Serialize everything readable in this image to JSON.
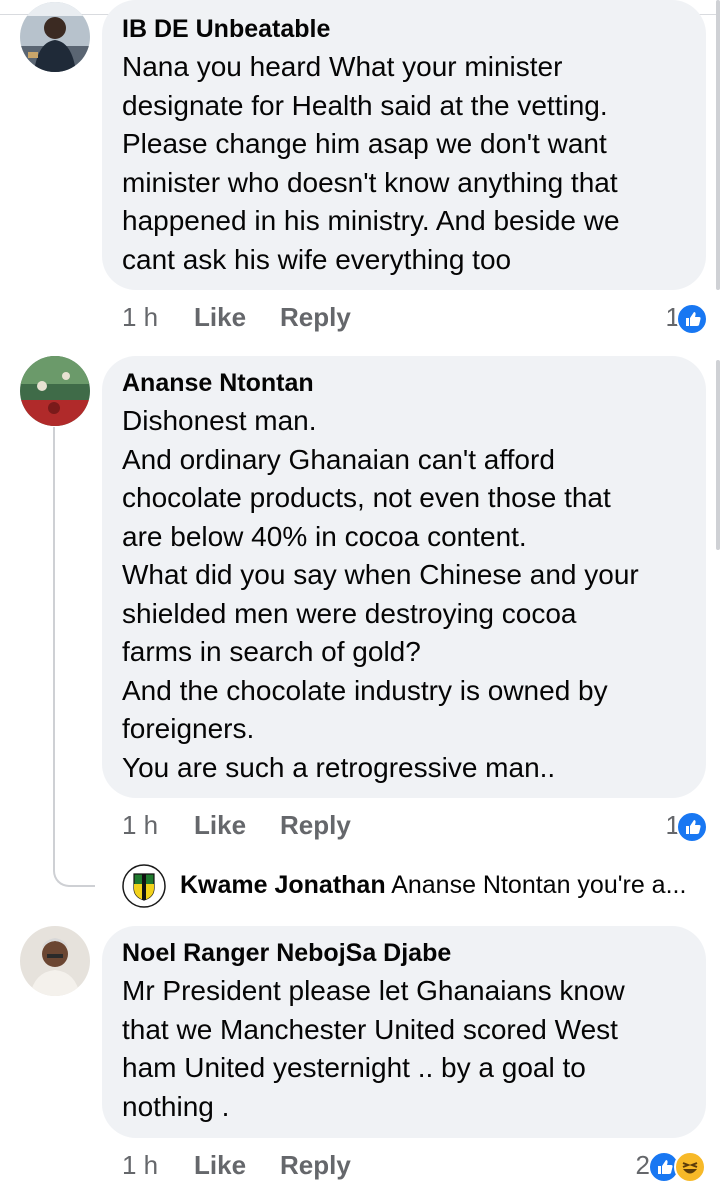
{
  "comments": [
    {
      "author": "IB DE Unbeatable",
      "lines": [
        "Nana you heard What your minister",
        "designate for Health said at the vetting.",
        "Please change him asap we don't want",
        "minister who doesn't know anything that",
        "happened in his ministry.  And beside we",
        "cant ask his wife everything too"
      ],
      "time": "1 h",
      "like_label": "Like",
      "reply_label": "Reply",
      "reaction_count": "1",
      "reactions": [
        "like-icon"
      ]
    },
    {
      "author": "Ananse Ntontan",
      "lines": [
        "Dishonest man.",
        "And ordinary Ghanaian can't afford",
        "chocolate products, not even those that",
        "are below 40% in cocoa content.",
        "What did you say when Chinese and your",
        "shielded men were destroying cocoa",
        "farms in search of gold?",
        "And the chocolate industry is owned by",
        "foreigners.",
        "You are such a retrogressive man.."
      ],
      "time": "1 h",
      "like_label": "Like",
      "reply_label": "Reply",
      "reaction_count": "1",
      "reactions": [
        "like-icon"
      ],
      "reply_preview": {
        "author": "Kwame Jonathan",
        "text": "Ananse Ntontan you're a..."
      }
    },
    {
      "author": "Noel Ranger NebojSa Djabe",
      "lines": [
        "Mr President please let Ghanaians know",
        "that we Manchester United scored West",
        "ham United yesternight .. by a goal to",
        "nothing ."
      ],
      "time": "1 h",
      "like_label": "Like",
      "reply_label": "Reply",
      "reaction_count": "2",
      "reactions": [
        "like-icon",
        "haha-icon"
      ]
    }
  ],
  "colors": {
    "bubble": "#f0f2f5",
    "meta": "#65676b",
    "like_blue": "#1877f2",
    "haha_yellow": "#f7b928"
  }
}
